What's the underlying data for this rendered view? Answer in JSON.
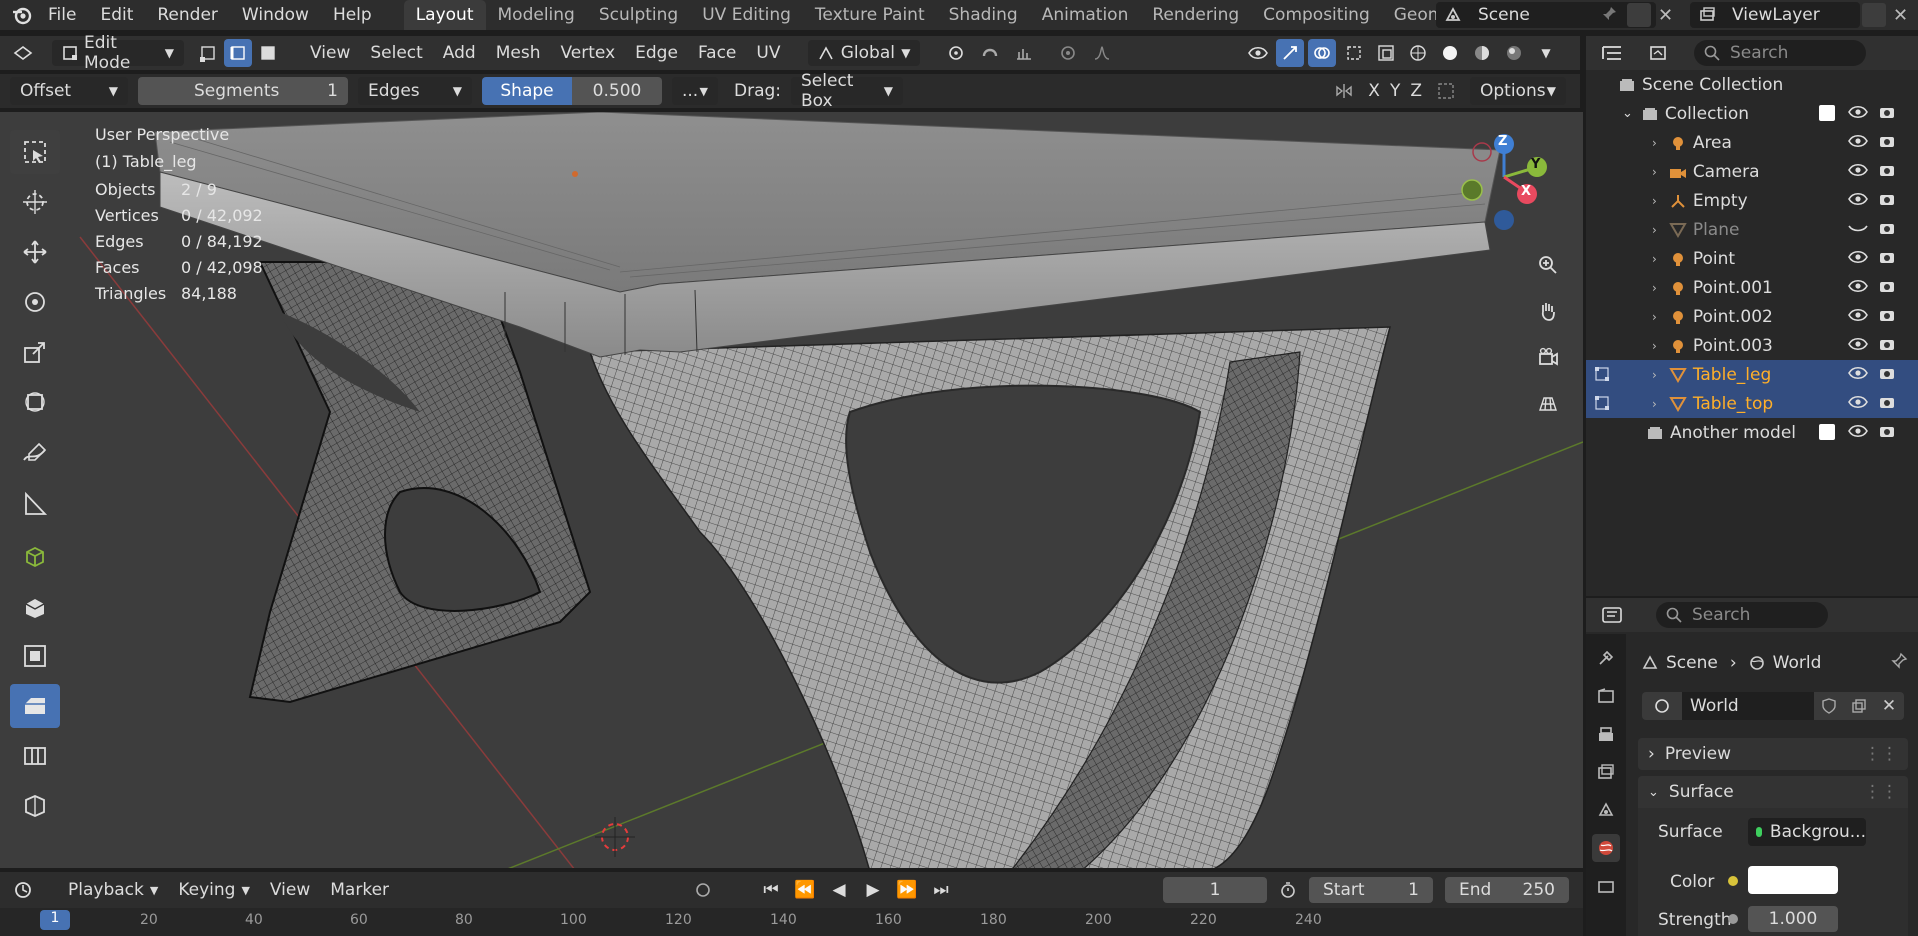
{
  "topbar": {
    "menus": [
      "File",
      "Edit",
      "Render",
      "Window",
      "Help"
    ],
    "workspaces": [
      "Layout",
      "Modeling",
      "Sculpting",
      "UV Editing",
      "Texture Paint",
      "Shading",
      "Animation",
      "Rendering",
      "Compositing",
      "Geomet"
    ],
    "active_workspace": "Layout",
    "scene": "Scene",
    "view_layer": "ViewLayer"
  },
  "header": {
    "mode": "Edit Mode",
    "menus": [
      "View",
      "Select",
      "Add",
      "Mesh",
      "Vertex",
      "Edge",
      "Face",
      "UV"
    ],
    "transform_orientation": "Global"
  },
  "toolsettings": {
    "offset": "Offset",
    "segments_label": "Segments",
    "segments_value": "1",
    "affect": "Edges",
    "shape_label": "Shape",
    "shape_value": "0.500",
    "more": "...",
    "drag_label": "Drag:",
    "drag_value": "Select Box",
    "axes": [
      "X",
      "Y",
      "Z"
    ],
    "options": "Options"
  },
  "viewport": {
    "view_name": "User Perspective",
    "object_name": "(1) Table_leg",
    "stats": [
      {
        "label": "Objects",
        "value": "2 / 9"
      },
      {
        "label": "Vertices",
        "value": "0 / 42,092"
      },
      {
        "label": "Edges",
        "value": "0 / 84,192"
      },
      {
        "label": "Faces",
        "value": "0 / 42,098"
      },
      {
        "label": "Triangles",
        "value": "84,188"
      }
    ],
    "gizmo": {
      "x": "X",
      "y": "Y",
      "z": "Z"
    }
  },
  "outliner": {
    "search_placeholder": "Search",
    "root": "Scene Collection",
    "collection": "Collection",
    "items": [
      {
        "name": "Area",
        "type": "light",
        "selected": false
      },
      {
        "name": "Camera",
        "type": "camera",
        "selected": false
      },
      {
        "name": "Empty",
        "type": "empty",
        "selected": false
      },
      {
        "name": "Plane",
        "type": "mesh",
        "selected": false,
        "hidden": true
      },
      {
        "name": "Point",
        "type": "light",
        "selected": false
      },
      {
        "name": "Point.001",
        "type": "light",
        "selected": false
      },
      {
        "name": "Point.002",
        "type": "light",
        "selected": false
      },
      {
        "name": "Point.003",
        "type": "light",
        "selected": false
      },
      {
        "name": "Table_leg",
        "type": "mesh",
        "selected": true
      },
      {
        "name": "Table_top",
        "type": "mesh",
        "selected": true
      }
    ],
    "other_collection": "Another model"
  },
  "properties": {
    "search_placeholder": "Search",
    "breadcrumb": [
      "Scene",
      "World"
    ],
    "world_name": "World",
    "panels": {
      "preview": "Preview",
      "surface": "Surface"
    },
    "surface_label": "Surface",
    "surface_value": "Backgrou...",
    "color_label": "Color",
    "strength_label": "Strength",
    "strength_value": "1.000"
  },
  "timeline": {
    "menus": [
      "Playback",
      "Keying",
      "View",
      "Marker"
    ],
    "current_frame": "1",
    "start_label": "Start",
    "start_value": "1",
    "end_label": "End",
    "end_value": "250",
    "ruler": [
      "1",
      "20",
      "40",
      "60",
      "80",
      "100",
      "120",
      "140",
      "160",
      "180",
      "200",
      "220",
      "240"
    ]
  },
  "colors": {
    "accent": "#4772b3",
    "selected_text": "#ffaf29",
    "axis_x": "#e84a5f",
    "axis_y": "#8ab93b",
    "axis_z": "#3f7fd4"
  }
}
